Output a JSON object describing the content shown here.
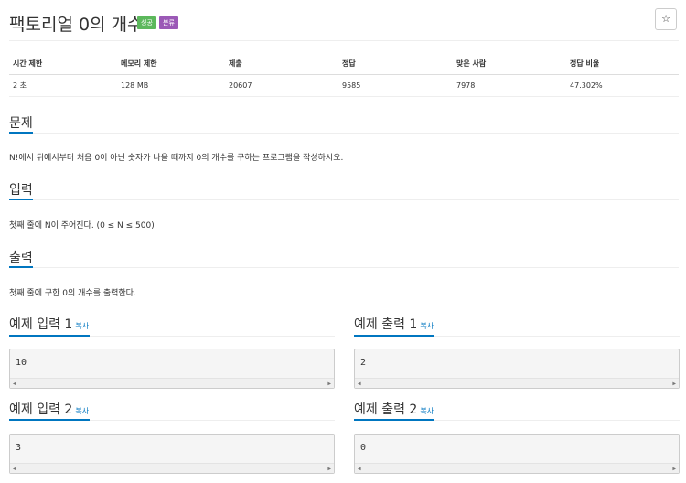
{
  "problem": {
    "title": "팩토리얼 0의 개수",
    "badge_success": "성공",
    "badge_category": "분류",
    "star_label": "☆"
  },
  "info": {
    "headers": [
      "시간 제한",
      "메모리 제한",
      "제출",
      "정답",
      "맞은 사람",
      "정답 비율"
    ],
    "values": [
      "2 초",
      "128 MB",
      "20607",
      "9585",
      "7978",
      "47.302%"
    ]
  },
  "sections": {
    "problem_heading": "문제",
    "problem_text": "N!에서 뒤에서부터 처음 0이 아닌 숫자가 나올 때까지 0의 개수를 구하는 프로그램을 작성하시오.",
    "input_heading": "입력",
    "input_text": "첫째 줄에 N이 주어진다. (0 ≤ N ≤ 500)",
    "output_heading": "출력",
    "output_text": "첫째 줄에 구한 0의 개수를 출력한다."
  },
  "examples": {
    "copy_label": "복사",
    "in1_title": "예제 입력 1",
    "in1_value": "10",
    "out1_title": "예제 출력 1",
    "out1_value": "2",
    "in2_title": "예제 입력 2",
    "in2_value": "3",
    "out2_title": "예제 출력 2",
    "out2_value": "0"
  },
  "colors": {
    "success": "#5cb85c",
    "category": "#9b59b6",
    "accent": "#0076c0"
  }
}
